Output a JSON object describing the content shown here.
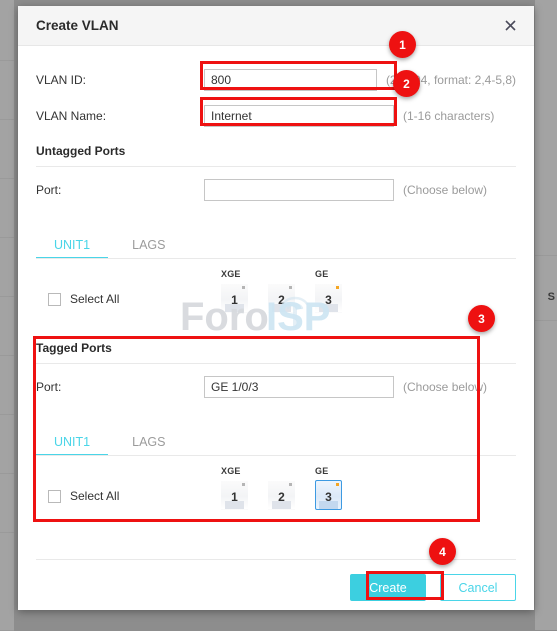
{
  "dialog": {
    "title": "Create VLAN",
    "close_icon": "close-icon"
  },
  "form": {
    "vlan_id": {
      "label": "VLAN ID:",
      "value": "800",
      "hint": "(2-4094, format: 2,4-5,8)"
    },
    "vlan_name": {
      "label": "VLAN Name:",
      "value": "Internet",
      "hint": "(1-16 characters)"
    }
  },
  "untagged": {
    "section_title": "Untagged Ports",
    "port_label": "Port:",
    "port_value": "",
    "port_placeholder": "",
    "port_hint": "(Choose below)",
    "tabs": [
      {
        "label": "UNIT1",
        "active": true
      },
      {
        "label": "LAGS",
        "active": false
      }
    ],
    "select_all_label": "Select All",
    "group_labels": [
      {
        "text": "XGE"
      },
      {
        "text": "GE"
      }
    ],
    "ports": [
      {
        "num": "1",
        "selected": false,
        "led": "off"
      },
      {
        "num": "2",
        "selected": false,
        "led": "off"
      },
      {
        "num": "3",
        "selected": false,
        "led": "on"
      }
    ]
  },
  "tagged": {
    "section_title": "Tagged Ports",
    "port_label": "Port:",
    "port_value": "GE 1/0/3",
    "port_hint": "(Choose below)",
    "tabs": [
      {
        "label": "UNIT1",
        "active": true
      },
      {
        "label": "LAGS",
        "active": false
      }
    ],
    "select_all_label": "Select All",
    "group_labels": [
      {
        "text": "XGE"
      },
      {
        "text": "GE"
      }
    ],
    "ports": [
      {
        "num": "1",
        "selected": false,
        "led": "off"
      },
      {
        "num": "2",
        "selected": false,
        "led": "off"
      },
      {
        "num": "3",
        "selected": true,
        "led": "on"
      }
    ]
  },
  "footer": {
    "create_label": "Create",
    "cancel_label": "Cancel"
  },
  "annotations": {
    "badges": [
      "1",
      "2",
      "3",
      "4"
    ],
    "color": "#ee1111"
  },
  "watermark": {
    "text_a": "Foro",
    "text_b": "ISP"
  },
  "background": {
    "right_letter": "S"
  },
  "colors": {
    "accent": "#4ad5e8",
    "primary_button": "#3ccfe0",
    "annotation_red": "#ee1111",
    "led_on": "#f5a623",
    "port_selected_border": "#3d9ae2"
  }
}
